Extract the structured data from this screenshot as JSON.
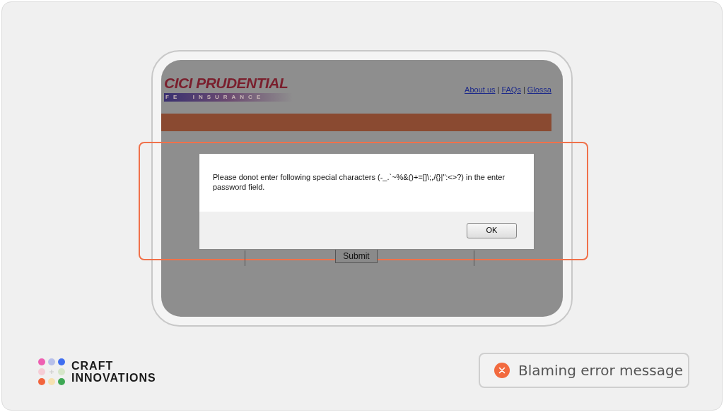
{
  "screen": {
    "logo": {
      "brand": "CICI PRUDENTIAL",
      "tagline": "FE  INSURANCE"
    },
    "nav": [
      {
        "label": "About us"
      },
      {
        "label": "FAQs"
      },
      {
        "label": "Glossa"
      }
    ],
    "nav_separators": [
      "|",
      "|"
    ],
    "submit": "Submit"
  },
  "dialog": {
    "message": "Please donot enter following special characters (-_.`~%&()+=[]\\;,/{}|\":<>?) in the enter password field.",
    "button": "OK"
  },
  "brand": {
    "lines": [
      "CRAFT",
      "INNOVATIONS"
    ]
  },
  "verdict": {
    "error": true,
    "text": "Blaming error message"
  }
}
